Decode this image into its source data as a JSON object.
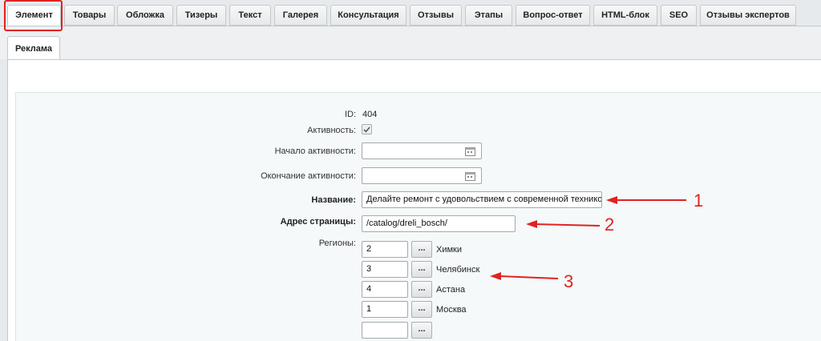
{
  "tabs": [
    {
      "label": "Элемент",
      "active": true
    },
    {
      "label": "Товары"
    },
    {
      "label": "Обложка"
    },
    {
      "label": "Тизеры"
    },
    {
      "label": "Текст"
    },
    {
      "label": "Галерея"
    },
    {
      "label": "Консультация"
    },
    {
      "label": "Отзывы"
    },
    {
      "label": "Этапы"
    },
    {
      "label": "Вопрос-ответ"
    },
    {
      "label": "HTML-блок"
    },
    {
      "label": "SEO"
    },
    {
      "label": "Отзывы экспертов"
    }
  ],
  "subtabs": [
    {
      "label": "Реклама"
    }
  ],
  "form": {
    "id_label": "ID:",
    "id_value": "404",
    "active_label": "Активность:",
    "active_checked": true,
    "active_from_label": "Начало активности:",
    "active_from_value": "",
    "active_to_label": "Окончание активности:",
    "active_to_value": "",
    "name_label": "Название:",
    "name_value": "Делайте ремонт с удовольствием  с современной техникой Bosch",
    "url_label": "Адрес страницы:",
    "url_value": "/catalog/dreli_bosch/",
    "regions_label": "Регионы:",
    "regions": [
      {
        "value": "2",
        "name": "Химки"
      },
      {
        "value": "3",
        "name": "Челябинск"
      },
      {
        "value": "4",
        "name": "Астана"
      },
      {
        "value": "1",
        "name": "Москва"
      },
      {
        "value": "",
        "name": ""
      }
    ],
    "dots_label": "..."
  },
  "annotations": {
    "color": "#e02222",
    "labels": [
      "1",
      "2",
      "3"
    ]
  },
  "icons": {
    "checkbox": "check-icon",
    "calendar": "calendar-icon"
  }
}
